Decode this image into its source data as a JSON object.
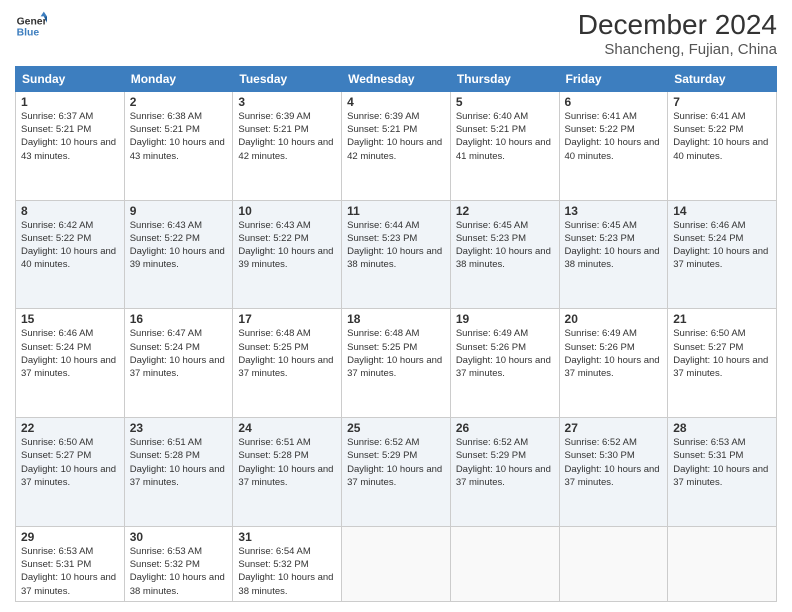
{
  "header": {
    "logo_line1": "General",
    "logo_line2": "Blue",
    "title": "December 2024",
    "subtitle": "Shancheng, Fujian, China"
  },
  "columns": [
    "Sunday",
    "Monday",
    "Tuesday",
    "Wednesday",
    "Thursday",
    "Friday",
    "Saturday"
  ],
  "weeks": [
    [
      {
        "day": "1",
        "sunrise": "6:37 AM",
        "sunset": "5:21 PM",
        "daylight": "10 hours and 43 minutes."
      },
      {
        "day": "2",
        "sunrise": "6:38 AM",
        "sunset": "5:21 PM",
        "daylight": "10 hours and 43 minutes."
      },
      {
        "day": "3",
        "sunrise": "6:39 AM",
        "sunset": "5:21 PM",
        "daylight": "10 hours and 42 minutes."
      },
      {
        "day": "4",
        "sunrise": "6:39 AM",
        "sunset": "5:21 PM",
        "daylight": "10 hours and 42 minutes."
      },
      {
        "day": "5",
        "sunrise": "6:40 AM",
        "sunset": "5:21 PM",
        "daylight": "10 hours and 41 minutes."
      },
      {
        "day": "6",
        "sunrise": "6:41 AM",
        "sunset": "5:22 PM",
        "daylight": "10 hours and 40 minutes."
      },
      {
        "day": "7",
        "sunrise": "6:41 AM",
        "sunset": "5:22 PM",
        "daylight": "10 hours and 40 minutes."
      }
    ],
    [
      {
        "day": "8",
        "sunrise": "6:42 AM",
        "sunset": "5:22 PM",
        "daylight": "10 hours and 40 minutes."
      },
      {
        "day": "9",
        "sunrise": "6:43 AM",
        "sunset": "5:22 PM",
        "daylight": "10 hours and 39 minutes."
      },
      {
        "day": "10",
        "sunrise": "6:43 AM",
        "sunset": "5:22 PM",
        "daylight": "10 hours and 39 minutes."
      },
      {
        "day": "11",
        "sunrise": "6:44 AM",
        "sunset": "5:23 PM",
        "daylight": "10 hours and 38 minutes."
      },
      {
        "day": "12",
        "sunrise": "6:45 AM",
        "sunset": "5:23 PM",
        "daylight": "10 hours and 38 minutes."
      },
      {
        "day": "13",
        "sunrise": "6:45 AM",
        "sunset": "5:23 PM",
        "daylight": "10 hours and 38 minutes."
      },
      {
        "day": "14",
        "sunrise": "6:46 AM",
        "sunset": "5:24 PM",
        "daylight": "10 hours and 37 minutes."
      }
    ],
    [
      {
        "day": "15",
        "sunrise": "6:46 AM",
        "sunset": "5:24 PM",
        "daylight": "10 hours and 37 minutes."
      },
      {
        "day": "16",
        "sunrise": "6:47 AM",
        "sunset": "5:24 PM",
        "daylight": "10 hours and 37 minutes."
      },
      {
        "day": "17",
        "sunrise": "6:48 AM",
        "sunset": "5:25 PM",
        "daylight": "10 hours and 37 minutes."
      },
      {
        "day": "18",
        "sunrise": "6:48 AM",
        "sunset": "5:25 PM",
        "daylight": "10 hours and 37 minutes."
      },
      {
        "day": "19",
        "sunrise": "6:49 AM",
        "sunset": "5:26 PM",
        "daylight": "10 hours and 37 minutes."
      },
      {
        "day": "20",
        "sunrise": "6:49 AM",
        "sunset": "5:26 PM",
        "daylight": "10 hours and 37 minutes."
      },
      {
        "day": "21",
        "sunrise": "6:50 AM",
        "sunset": "5:27 PM",
        "daylight": "10 hours and 37 minutes."
      }
    ],
    [
      {
        "day": "22",
        "sunrise": "6:50 AM",
        "sunset": "5:27 PM",
        "daylight": "10 hours and 37 minutes."
      },
      {
        "day": "23",
        "sunrise": "6:51 AM",
        "sunset": "5:28 PM",
        "daylight": "10 hours and 37 minutes."
      },
      {
        "day": "24",
        "sunrise": "6:51 AM",
        "sunset": "5:28 PM",
        "daylight": "10 hours and 37 minutes."
      },
      {
        "day": "25",
        "sunrise": "6:52 AM",
        "sunset": "5:29 PM",
        "daylight": "10 hours and 37 minutes."
      },
      {
        "day": "26",
        "sunrise": "6:52 AM",
        "sunset": "5:29 PM",
        "daylight": "10 hours and 37 minutes."
      },
      {
        "day": "27",
        "sunrise": "6:52 AM",
        "sunset": "5:30 PM",
        "daylight": "10 hours and 37 minutes."
      },
      {
        "day": "28",
        "sunrise": "6:53 AM",
        "sunset": "5:31 PM",
        "daylight": "10 hours and 37 minutes."
      }
    ],
    [
      {
        "day": "29",
        "sunrise": "6:53 AM",
        "sunset": "5:31 PM",
        "daylight": "10 hours and 37 minutes."
      },
      {
        "day": "30",
        "sunrise": "6:53 AM",
        "sunset": "5:32 PM",
        "daylight": "10 hours and 38 minutes."
      },
      {
        "day": "31",
        "sunrise": "6:54 AM",
        "sunset": "5:32 PM",
        "daylight": "10 hours and 38 minutes."
      },
      null,
      null,
      null,
      null
    ]
  ]
}
